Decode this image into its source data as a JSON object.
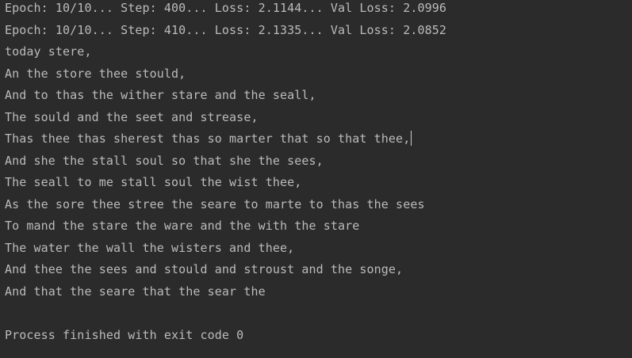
{
  "console": {
    "lines": [
      "Epoch: 10/10... Step: 400... Loss: 2.1144... Val Loss: 2.0996",
      "Epoch: 10/10... Step: 410... Loss: 2.1335... Val Loss: 2.0852",
      "today stere,",
      "An the store thee stould,",
      "And to thas the wither stare and the seall,",
      "The sould and the seet and strease,",
      "Thas thee thas sherest thas so marter that so that thee,",
      "And she the stall soul so that she the sees,",
      "The seall to me stall soul the wist thee,",
      "As the sore thee stree the seare to marte to thas the sees",
      "To mand the stare the ware and the with the stare",
      "The water the wall the wisters and thee,",
      "And thee the sees and stould and stroust and the songe,",
      "And that the seare that the sear the"
    ],
    "exit_message": "Process finished with exit code 0"
  }
}
